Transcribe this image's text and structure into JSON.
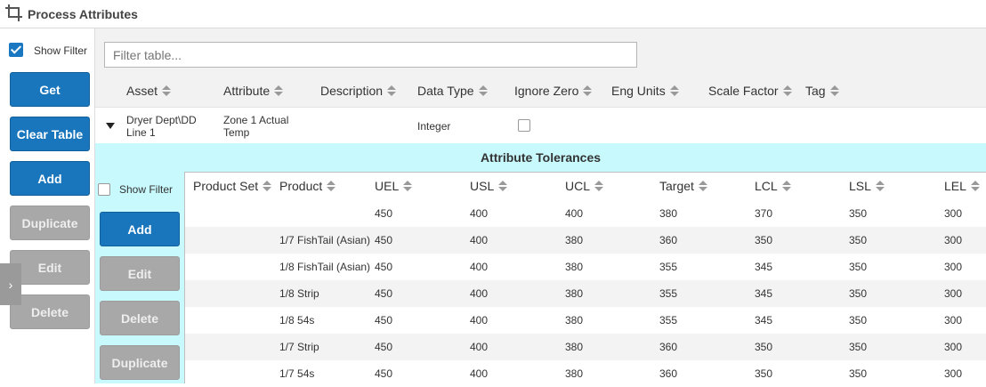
{
  "window": {
    "title": "Process Attributes",
    "icon": "crop-icon"
  },
  "sidebar": {
    "show_filter_label": "Show Filter",
    "show_filter_checked": true,
    "buttons": [
      "Get",
      "Clear Table",
      "Add",
      "Duplicate",
      "Edit",
      "Delete"
    ],
    "expander_glyph": "›"
  },
  "main": {
    "filter_placeholder": "Filter table...",
    "columns": [
      "Asset",
      "Attribute",
      "Description",
      "Data Type",
      "Ignore Zero",
      "Eng Units",
      "Scale Factor",
      "Tag"
    ],
    "row": {
      "asset": "Dryer Dept\\DD Line 1",
      "asset_line1": "Dryer Dept\\DD",
      "asset_line2": "Line 1",
      "attribute_line1": "Zone 1 Actual",
      "attribute_line2": "Temp",
      "description": "",
      "data_type": "Integer",
      "ignore_zero": false
    }
  },
  "tolerances": {
    "title": "Attribute Tolerances",
    "show_filter_label": "Show Filter",
    "show_filter_checked": false,
    "buttons": [
      "Add",
      "Edit",
      "Delete",
      "Duplicate"
    ],
    "columns": [
      "Product Set",
      "Product",
      "UEL",
      "USL",
      "UCL",
      "Target",
      "LCL",
      "LSL",
      "LEL"
    ],
    "rows": [
      {
        "product_set": "",
        "product": "",
        "uel": "450",
        "usl": "400",
        "ucl": "400",
        "target": "380",
        "lcl": "370",
        "lsl": "350",
        "lel": "300"
      },
      {
        "product_set": "",
        "product": "1/7 FishTail (Asian)",
        "uel": "450",
        "usl": "400",
        "ucl": "380",
        "target": "360",
        "lcl": "350",
        "lsl": "350",
        "lel": "300"
      },
      {
        "product_set": "",
        "product": "1/8 FishTail (Asian)",
        "uel": "450",
        "usl": "400",
        "ucl": "380",
        "target": "355",
        "lcl": "345",
        "lsl": "350",
        "lel": "300"
      },
      {
        "product_set": "",
        "product": "1/8 Strip",
        "uel": "450",
        "usl": "400",
        "ucl": "380",
        "target": "355",
        "lcl": "345",
        "lsl": "350",
        "lel": "300"
      },
      {
        "product_set": "",
        "product": "1/8 54s",
        "uel": "450",
        "usl": "400",
        "ucl": "380",
        "target": "355",
        "lcl": "345",
        "lsl": "350",
        "lel": "300"
      },
      {
        "product_set": "",
        "product": "1/7 Strip",
        "uel": "450",
        "usl": "400",
        "ucl": "380",
        "target": "360",
        "lcl": "350",
        "lsl": "350",
        "lel": "300"
      },
      {
        "product_set": "",
        "product": "1/7 54s",
        "uel": "450",
        "usl": "400",
        "ucl": "380",
        "target": "360",
        "lcl": "350",
        "lsl": "350",
        "lel": "300"
      }
    ]
  },
  "colors": {
    "primary": "#1976bc",
    "disabled": "#a8a8a8",
    "tolerance_bg": "#c8fafd",
    "grid_bg": "#f2f2f2"
  }
}
